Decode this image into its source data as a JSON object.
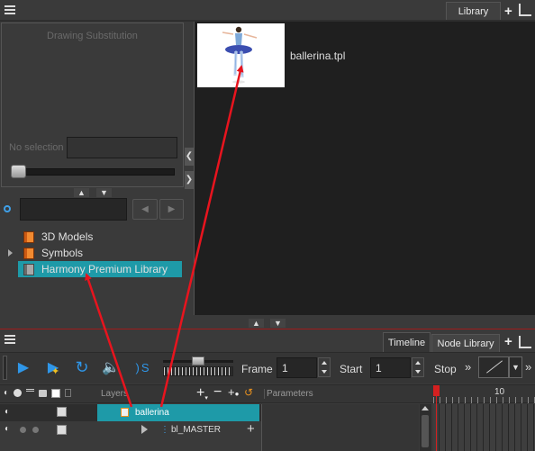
{
  "library": {
    "tab_label": "Library",
    "drawing_substitution_label": "Drawing Substitution",
    "no_selection_label": "No selection",
    "items": [
      {
        "label": "3D Models",
        "icon": "book-orange-icon"
      },
      {
        "label": "Symbols",
        "icon": "book-orange-icon"
      },
      {
        "label": "Harmony Premium Library",
        "icon": "book-grey-icon"
      }
    ],
    "template": {
      "name": "ballerina.tpl"
    }
  },
  "timeline": {
    "tabs": [
      "Timeline",
      "Node Library"
    ],
    "frame_label": "Frame",
    "frame_value": "1",
    "start_label": "Start",
    "start_value": "1",
    "stop_label": "Stop",
    "layers_header": "Layers",
    "parameters_header": "Parameters",
    "frame_ruler_marker": "10",
    "layers": [
      {
        "name": "ballerina",
        "selected": true
      },
      {
        "name": "bl_MASTER",
        "selected": false
      }
    ]
  },
  "colors": {
    "selection": "#1e9aa8",
    "annotation_arrow": "#e8141e",
    "playhead": "#d42020"
  }
}
